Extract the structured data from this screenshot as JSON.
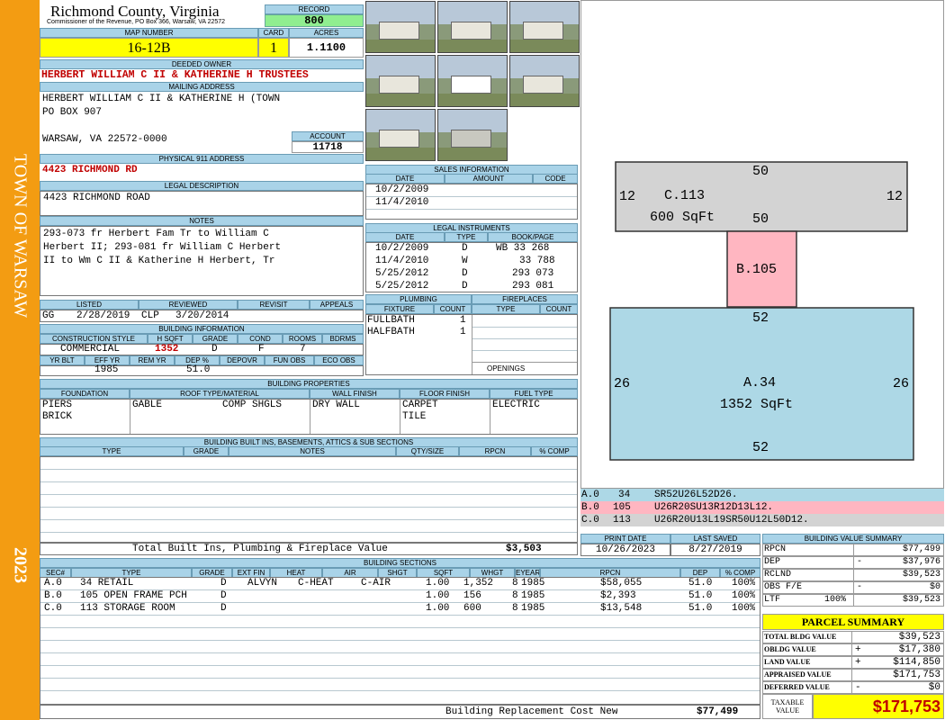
{
  "sidebar": {
    "town": "TOWN OF WARSAW",
    "year": "2023"
  },
  "header": {
    "county": "Richmond County, Virginia",
    "commissioner": "Commissioner of the Revenue, PO Box 366, Warsaw, VA 22572",
    "record_label": "RECORD",
    "record": "800",
    "map_label": "MAP NUMBER",
    "map": "16-12B",
    "card_label": "CARD",
    "card": "1",
    "acres_label": "ACRES",
    "acres": "1.1100"
  },
  "owner": {
    "label": "DEEDED OWNER",
    "name": "HERBERT WILLIAM C II & KATHERINE H TRUSTEES",
    "mail_label": "MAILING ADDRESS",
    "mail1": "HERBERT WILLIAM C II & KATHERINE H (TOWN",
    "mail2": "PO BOX 907",
    "mail3": "WARSAW, VA 22572-0000",
    "account_label": "ACCOUNT",
    "account": "11718",
    "phys_label": "PHYSICAL 911 ADDRESS",
    "phys": "4423 RICHMOND RD",
    "legal_label": "LEGAL DESCRIPTION",
    "legal": "4423 RICHMOND ROAD",
    "notes_label": "NOTES",
    "notes1": "293-073 fr Herbert Fam Tr to William C",
    "notes2": "Herbert II; 293-081 fr William C Herbert",
    "notes3": "II to Wm C II & Katherine H Herbert, Tr"
  },
  "review": {
    "listed_label": "LISTED",
    "reviewed_label": "REVIEWED",
    "revisit_label": "REVISIT",
    "appeals_label": "APPEALS",
    "listed_by": "GG",
    "listed_date": "2/28/2019",
    "reviewed_by": "CLP",
    "reviewed_date": "3/20/2014"
  },
  "building": {
    "label": "BUILDING INFORMATION",
    "cs_label": "CONSTRUCTION STYLE",
    "hsqft_label": "H SQFT",
    "grade_label": "GRADE",
    "cond_label": "COND",
    "rooms_label": "ROOMS",
    "bdrms_label": "BDRMS",
    "cs": "COMMERCIAL",
    "hsqft": "1352",
    "grade": "D",
    "cond": "F",
    "rooms": "7",
    "yrblt_label": "YR BLT",
    "effyr_label": "EFF YR",
    "remyr_label": "REM YR",
    "dep_label": "DEP %",
    "depovr_label": "DEPOVR",
    "funobs_label": "FUN OBS",
    "ecoobs_label": "ECO OBS",
    "effyr": "1985",
    "dep": "51.0"
  },
  "properties": {
    "label": "BUILDING PROPERTIES",
    "found_label": "FOUNDATION",
    "roof_label": "ROOF TYPE/MATERIAL",
    "wall_label": "WALL FINISH",
    "floor_label": "FLOOR FINISH",
    "fuel_label": "FUEL TYPE",
    "found1": "PIERS",
    "found2": "BRICK",
    "roof_type": "GABLE",
    "roof_mat": "COMP SHGLS",
    "wall": "DRY WALL",
    "floor1": "CARPET",
    "floor2": "TILE",
    "fuel": "ELECTRIC"
  },
  "builtins": {
    "label": "BUILDING BUILT INS, BASEMENTS, ATTICS & SUB SECTIONS",
    "type_label": "TYPE",
    "grade_label": "GRADE",
    "notes_label": "NOTES",
    "qty_label": "QTY/SIZE",
    "rpcn_label": "RPCN",
    "comp_label": "% COMP",
    "total_label": "Total Built Ins, Plumbing & Fireplace Value",
    "total": "$3,503"
  },
  "sales": {
    "label": "SALES INFORMATION",
    "date_label": "DATE",
    "amount_label": "AMOUNT",
    "code_label": "CODE",
    "rows": [
      {
        "date": "10/2/2009"
      },
      {
        "date": "11/4/2010"
      }
    ]
  },
  "instruments": {
    "label": "LEGAL INSTRUMENTS",
    "date_label": "DATE",
    "type_label": "TYPE",
    "bp_label": "BOOK/PAGE",
    "rows": [
      {
        "date": "10/2/2009",
        "type": "D",
        "bp": "WB 33 268"
      },
      {
        "date": "11/4/2010",
        "type": "W",
        "bp": "33 788"
      },
      {
        "date": "5/25/2012",
        "type": "D",
        "bp": "293 073"
      },
      {
        "date": "5/25/2012",
        "type": "D",
        "bp": "293 081"
      }
    ]
  },
  "plumbing": {
    "label": "PLUMBING",
    "fixture_label": "FIXTURE",
    "count_label": "COUNT",
    "rows": [
      {
        "fixture": "FULLBATH",
        "count": "1"
      },
      {
        "fixture": "HALFBATH",
        "count": "1"
      }
    ]
  },
  "fireplaces": {
    "label": "FIREPLACES",
    "type_label": "TYPE",
    "count_label": "COUNT",
    "openings_label": "OPENINGS"
  },
  "sketch": {
    "c_label": "C.113",
    "c_area": "600 SqFt",
    "c_top": "50",
    "c_bottom": "50",
    "c_left": "12",
    "c_right": "12",
    "b_label": "B.105",
    "a_label": "A.34",
    "a_area": "1352 SqFt",
    "a_top": "52",
    "a_bottom": "52",
    "a_left": "26",
    "a_right": "26",
    "legend": [
      {
        "id": "A.0",
        "code": "34",
        "path": "SR52U26L52D26.",
        "color": "#add8e6"
      },
      {
        "id": "B.0",
        "code": "105",
        "path": "U26R20SU13R12D13L12.",
        "color": "#ffb6c1"
      },
      {
        "id": "C.0",
        "code": "113",
        "path": "U26R20U13L19SR50U12L50D12.",
        "color": "#d3d3d3"
      }
    ]
  },
  "dates": {
    "print_label": "PRINT DATE",
    "saved_label": "LAST SAVED",
    "print": "10/26/2023",
    "saved": "8/27/2019"
  },
  "sections": {
    "label": "BUILDING SECTIONS",
    "cols": [
      "SEC#",
      "TYPE",
      "GRADE",
      "EXT FIN",
      "HEAT",
      "AIR",
      "SHGT",
      "SQFT",
      "WHGT",
      "EYEAR",
      "RPCN",
      "DEP",
      "% COMP"
    ],
    "rows": [
      {
        "sec": "A.0",
        "type": "34 RETAIL",
        "grade": "D",
        "ext": "ALVYN",
        "heat": "C-HEAT",
        "air": "C-AIR",
        "shgt": "1.00",
        "sqft": "1,352",
        "whgt": "8",
        "eyear": "1985",
        "rpcn": "$58,055",
        "dep": "51.0",
        "comp": "100%"
      },
      {
        "sec": "B.0",
        "type": "105 OPEN FRAME PCH",
        "grade": "D",
        "ext": "",
        "heat": "",
        "air": "",
        "shgt": "1.00",
        "sqft": "156",
        "whgt": "8",
        "eyear": "1985",
        "rpcn": "$2,393",
        "dep": "51.0",
        "comp": "100%"
      },
      {
        "sec": "C.0",
        "type": "113 STORAGE ROOM",
        "grade": "D",
        "ext": "",
        "heat": "",
        "air": "",
        "shgt": "1.00",
        "sqft": "600",
        "whgt": "8",
        "eyear": "1985",
        "rpcn": "$13,548",
        "dep": "51.0",
        "comp": "100%"
      }
    ],
    "total_label": "Building Replacement Cost New",
    "total": "$77,499"
  },
  "bvs": {
    "label": "BUILDING VALUE SUMMARY",
    "rows": [
      {
        "k": "RPCN",
        "op": "",
        "pct": "",
        "v": "$77,499"
      },
      {
        "k": "DEP",
        "op": "-",
        "pct": "",
        "v": "$37,976"
      },
      {
        "k": "RCLND",
        "op": "",
        "pct": "",
        "v": "$39,523"
      },
      {
        "k": "OBS F/E",
        "op": "-",
        "pct": "",
        "v": "$0"
      },
      {
        "k": "LTF",
        "op": "",
        "pct": "100%",
        "v": "$39,523"
      }
    ]
  },
  "parcel": {
    "label": "PARCEL SUMMARY",
    "rows": [
      {
        "k": "TOTAL BLDG VALUE",
        "op": "",
        "v": "$39,523"
      },
      {
        "k": "OBLDG VALUE",
        "op": "+",
        "v": "$17,380"
      },
      {
        "k": "LAND VALUE",
        "op": "+",
        "v": "$114,850"
      },
      {
        "k": "APPRAISED VALUE",
        "op": "",
        "v": "$171,753"
      },
      {
        "k": "DEFERRED VALUE",
        "op": "-",
        "v": "$0"
      }
    ],
    "taxable_label1": "TAXABLE",
    "taxable_label2": "VALUE",
    "taxable": "$171,753"
  },
  "colors": {
    "sidebar": "#f39c12",
    "header_bg": "#a9d3e8",
    "highlight": "#ffff00",
    "record": "#90ee90",
    "area_a": "#add8e6",
    "area_b": "#ffb6c1",
    "area_c": "#d3d3d3",
    "red": "#c00000"
  },
  "photos": [
    "photo-1",
    "photo-2",
    "photo-3",
    "photo-4",
    "photo-5",
    "photo-6",
    "photo-7",
    "photo-8"
  ]
}
